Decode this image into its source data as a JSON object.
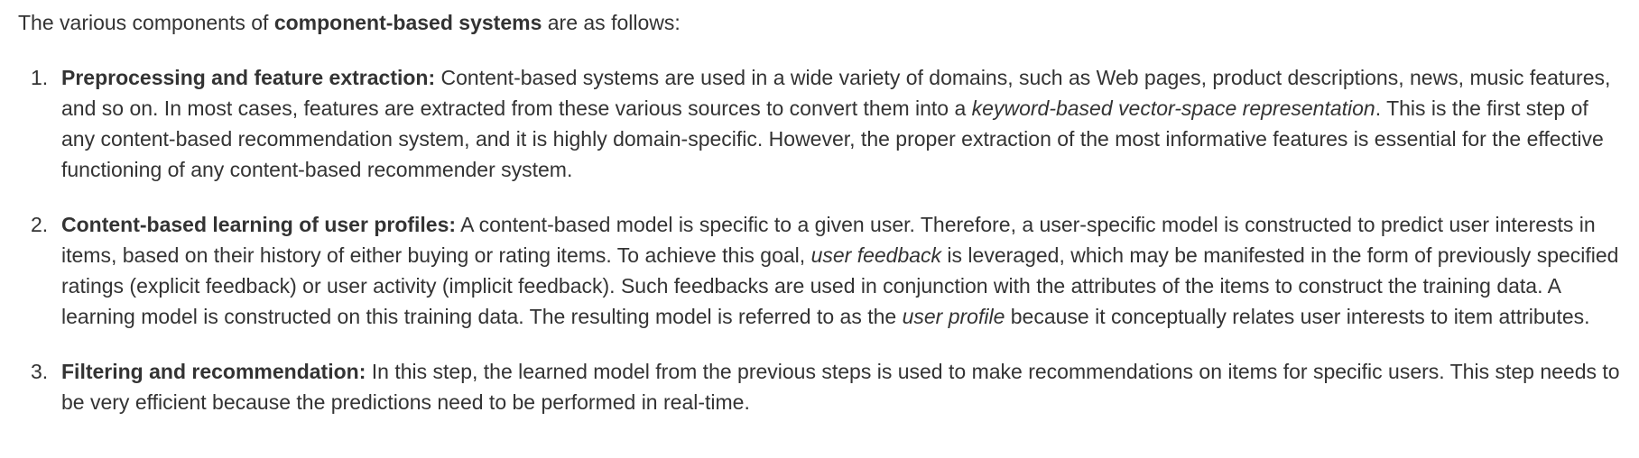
{
  "intro": {
    "prefix": "The various components of ",
    "bold": "component-based systems",
    "suffix": " are as follows:"
  },
  "items": [
    {
      "number": "1.",
      "title": "Preprocessing and feature extraction:",
      "t1": " Content-based systems are used in a wide variety of domains, such as Web pages, product descriptions, news, music features, and so on. In most cases, features are extracted from these various sources to convert them into a ",
      "em1": "keyword-based vector-space representation",
      "t2": ". This is the first step of any content-based recommendation system, and it is highly domain-specific. However, the proper extraction of the most informative features is essential for the effective functioning of any content-based recommender system."
    },
    {
      "number": "2.",
      "title": "Content-based learning of user profiles:",
      "t1": " A content-based model is specific to a given user. Therefore, a user-specific model is constructed to predict user interests in items, based on their history of either buying or rating items. To achieve this goal, ",
      "em1": "user feedback",
      "t2": " is leveraged, which may be manifested in the form of previously specified ratings (explicit feedback) or user activity (implicit feedback). Such feedbacks are used in conjunction with the attributes of the items to construct the training data. A learning model is constructed on this training data. The resulting model is referred to as the ",
      "em2": "user profile",
      "t3": " because it conceptually relates user interests to item attributes."
    },
    {
      "number": "3.",
      "title": "Filtering and recommendation:",
      "t1": " In this step, the learned model from the previous steps is used to make recommendations on items for specific users. This step needs to be very efficient because the predictions need to be performed in real-time."
    }
  ]
}
